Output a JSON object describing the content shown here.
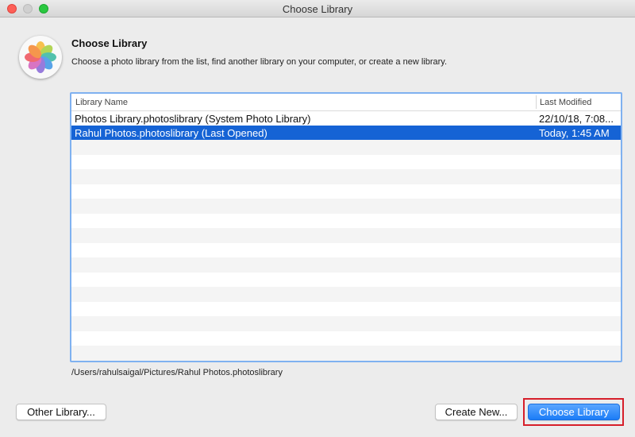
{
  "window": {
    "title": "Choose Library"
  },
  "header": {
    "heading": "Choose Library",
    "description": "Choose a photo library from the list, find another library on your computer, or create a new library."
  },
  "table": {
    "columns": [
      "Library Name",
      "Last Modified"
    ],
    "rows": [
      {
        "name": "Photos Library.photoslibrary (System Photo Library)",
        "modified": "22/10/18, 7:08...",
        "selected": false
      },
      {
        "name": "Rahul Photos.photoslibrary (Last Opened)",
        "modified": "Today, 1:45 AM",
        "selected": true
      }
    ]
  },
  "selected_path": "/Users/rahulsaigal/Pictures/Rahul Photos.photoslibrary",
  "buttons": {
    "other_library": "Other Library...",
    "create_new": "Create New...",
    "choose_library": "Choose Library"
  },
  "colors": {
    "selection": "#1563d5",
    "primary_button": "#1b7cf7",
    "highlight_outline": "#d61f2a"
  },
  "icons": [
    "photos-app-icon"
  ]
}
